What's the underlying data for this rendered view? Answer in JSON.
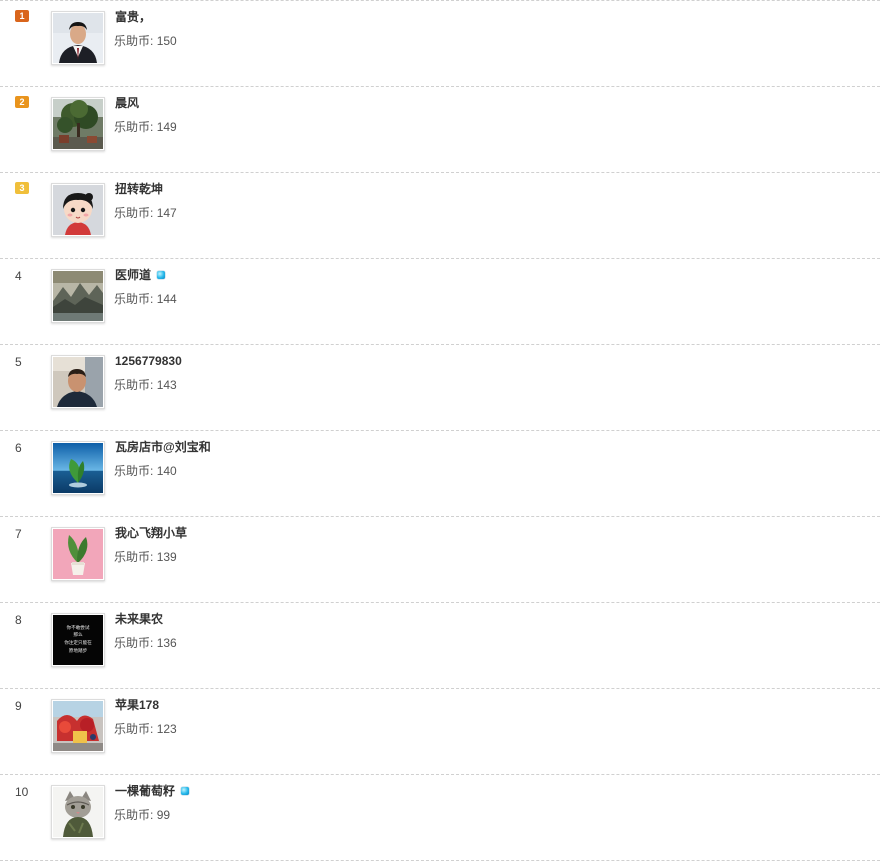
{
  "coin_label": "乐助币:",
  "colors": {
    "medal_1": "#d9651c",
    "medal_2": "#e9941d",
    "medal_3": "#f0bf3a",
    "vip_badge": "#26b8ea"
  },
  "ranking": [
    {
      "rank": "1",
      "name": "富贵，",
      "coins": "150",
      "vip": false,
      "avatar": "man-portrait"
    },
    {
      "rank": "2",
      "name": "晨风",
      "coins": "149",
      "vip": false,
      "avatar": "tree-photo"
    },
    {
      "rank": "3",
      "name": "扭转乾坤",
      "coins": "147",
      "vip": false,
      "avatar": "cartoon-girl"
    },
    {
      "rank": "4",
      "name": "医师道",
      "coins": "144",
      "vip": true,
      "avatar": "landscape-photo"
    },
    {
      "rank": "5",
      "name": "1256779830",
      "coins": "143",
      "vip": false,
      "avatar": "man-selfie"
    },
    {
      "rank": "6",
      "name": "瓦房店市@刘宝和",
      "coins": "140",
      "vip": false,
      "avatar": "leaf-ocean"
    },
    {
      "rank": "7",
      "name": "我心飞翔小草",
      "coins": "139",
      "vip": false,
      "avatar": "plant-pink"
    },
    {
      "rank": "8",
      "name": "未来果农",
      "coins": "136",
      "vip": false,
      "avatar": "text-image"
    },
    {
      "rank": "9",
      "name": "苹果178",
      "coins": "123",
      "vip": false,
      "avatar": "festival-photo"
    },
    {
      "rank": "10",
      "name": "一棵葡萄籽",
      "coins": "99",
      "vip": true,
      "avatar": "cat-photo"
    }
  ],
  "avatar_text": [
    "你不敢尝试",
    "那么",
    "你注定只能在",
    "原地踏步"
  ]
}
